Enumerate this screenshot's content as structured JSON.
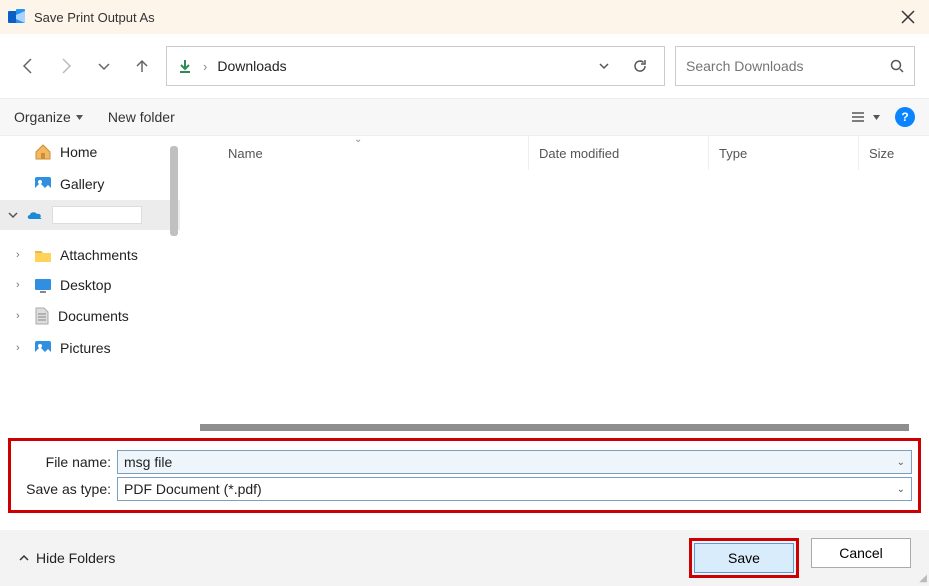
{
  "title": "Save Print Output As",
  "breadcrumb": {
    "location": "Downloads"
  },
  "search": {
    "placeholder": "Search Downloads"
  },
  "toolbar": {
    "organize": "Organize",
    "newfolder": "New folder"
  },
  "columns": {
    "name": "Name",
    "date": "Date modified",
    "type": "Type",
    "size": "Size"
  },
  "sidebar": {
    "home": "Home",
    "gallery": "Gallery",
    "attachments": "Attachments",
    "desktop": "Desktop",
    "documents": "Documents",
    "pictures": "Pictures"
  },
  "form": {
    "filename_label": "File name:",
    "filename_value": "msg file",
    "savetype_label": "Save as type:",
    "savetype_value": "PDF Document (*.pdf)"
  },
  "footer": {
    "hidefolders": "Hide Folders",
    "save": "Save",
    "cancel": "Cancel"
  }
}
